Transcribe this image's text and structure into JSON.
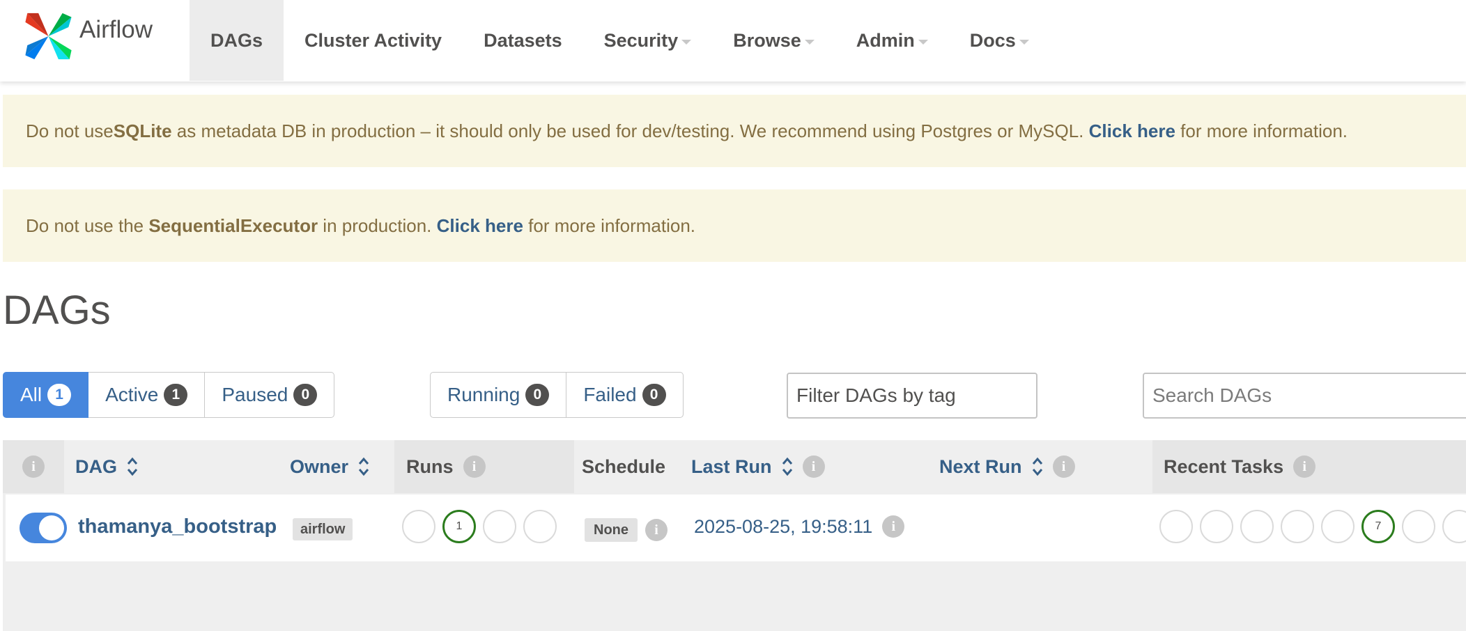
{
  "brand": {
    "name": "Airflow"
  },
  "nav": {
    "items": [
      {
        "label": "DAGs",
        "active": true
      },
      {
        "label": "Cluster Activity"
      },
      {
        "label": "Datasets"
      },
      {
        "label": "Security",
        "dropdown": true
      },
      {
        "label": "Browse",
        "dropdown": true
      },
      {
        "label": "Admin",
        "dropdown": true
      },
      {
        "label": "Docs",
        "dropdown": true
      }
    ]
  },
  "alerts": {
    "sqlite": {
      "pre": "Do not use ",
      "bold": "SQLite",
      "mid": " as metadata DB in production – it should only be used for dev/testing. We recommend using Postgres or MySQL. ",
      "link": "Click here",
      "post": " for more information."
    },
    "executor": {
      "pre": "Do not use the ",
      "bold": "SequentialExecutor",
      "mid": " in production. ",
      "link": "Click here",
      "post": " for more information."
    }
  },
  "page": {
    "title": "DAGs"
  },
  "filters": {
    "status": [
      {
        "label": "All",
        "count": "1",
        "active": true
      },
      {
        "label": "Active",
        "count": "1"
      },
      {
        "label": "Paused",
        "count": "0"
      }
    ],
    "state": [
      {
        "label": "Running",
        "count": "0"
      },
      {
        "label": "Failed",
        "count": "0"
      }
    ],
    "tag_placeholder": "Filter DAGs by tag",
    "search_placeholder": "Search DAGs"
  },
  "table": {
    "headers": {
      "info": "i",
      "dag": "DAG",
      "owner": "Owner",
      "runs": "Runs",
      "schedule": "Schedule",
      "last_run": "Last Run",
      "next_run": "Next Run",
      "recent_tasks": "Recent Tasks"
    },
    "rows": [
      {
        "enabled": true,
        "dag_id": "thamanya_bootstrap",
        "owner": "airflow",
        "runs": [
          "",
          "1",
          "",
          ""
        ],
        "schedule": "None",
        "last_run": "2025-08-25, 19:58:11",
        "next_run": "",
        "recent_tasks": [
          "",
          "",
          "",
          "",
          "",
          "7",
          "",
          ""
        ]
      }
    ]
  },
  "colors": {
    "primary": "#4686dd",
    "link": "#365f87",
    "alert_bg": "#f9f6e3",
    "alert_text": "#836e42",
    "success": "#2b7c1d"
  }
}
